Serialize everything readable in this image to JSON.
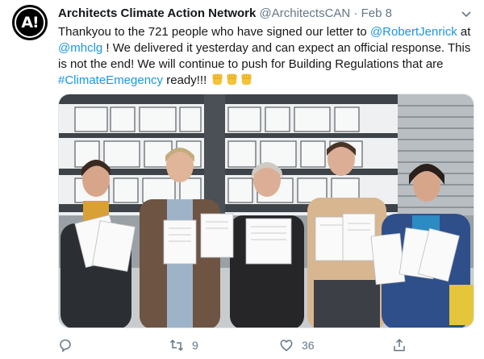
{
  "tweet": {
    "avatar_text": "A!",
    "author_name": "Architects Climate Action Network",
    "handle": "@ArchitectsCAN",
    "separator": "·",
    "date": "Feb 8",
    "text": {
      "part1": "Thankyou to the 721 people who have signed our letter to ",
      "mention1": "@RobertJenrick",
      "part2": " at ",
      "mention2": "@mhclg",
      "part3": " ! We delivered it yesterday and can expect an official response. This is not the end! We will continue to push for Building Regulations that are ",
      "hashtag": "#ClimateEmegency",
      "part4": " ready!!! "
    },
    "emoji": [
      "raised-fist",
      "raised-fist",
      "raised-fist"
    ]
  },
  "actions": {
    "reply_count": "",
    "retweet_count": "9",
    "like_count": "36"
  },
  "colors": {
    "link": "#1b95e0",
    "muted": "#657786",
    "text": "#14171a"
  }
}
